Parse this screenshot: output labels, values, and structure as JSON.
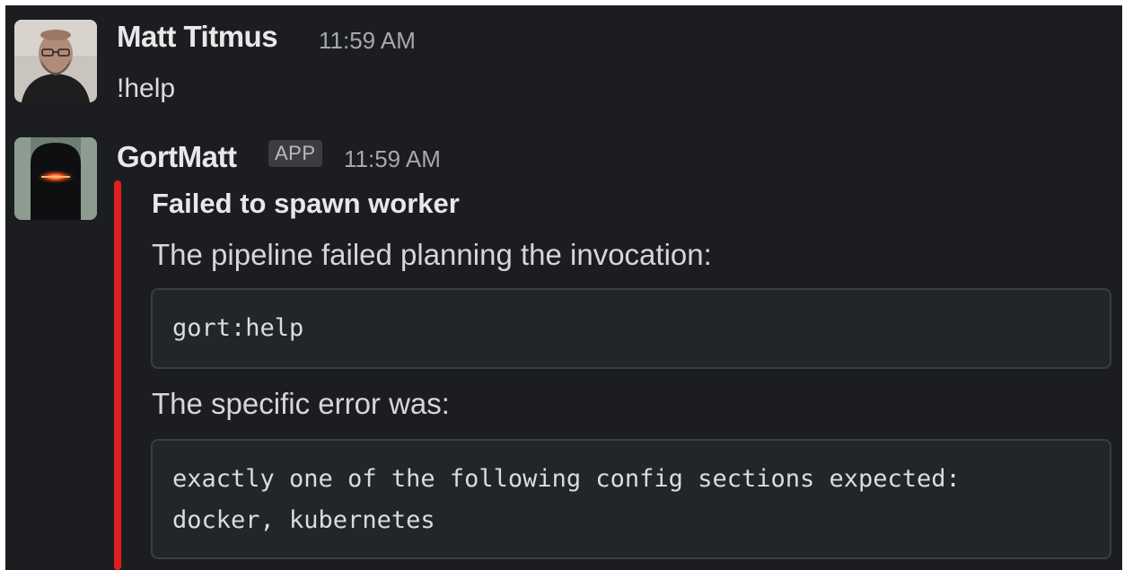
{
  "messages": [
    {
      "author": "Matt Titmus",
      "time": "11:59 AM",
      "text": "!help",
      "avatar_icon": "user-photo-avatar"
    },
    {
      "author": "GortMatt",
      "badge": "APP",
      "time": "11:59 AM",
      "avatar_icon": "bot-avatar",
      "attachment": {
        "accent_color": "#e01e1e",
        "title": "Failed to spawn worker",
        "intro": "The pipeline failed planning the invocation:",
        "command": "gort:help",
        "error_intro": "The specific error was:",
        "error_lines": [
          "exactly one of the following config sections expected:",
          "docker, kubernetes"
        ]
      }
    }
  ]
}
